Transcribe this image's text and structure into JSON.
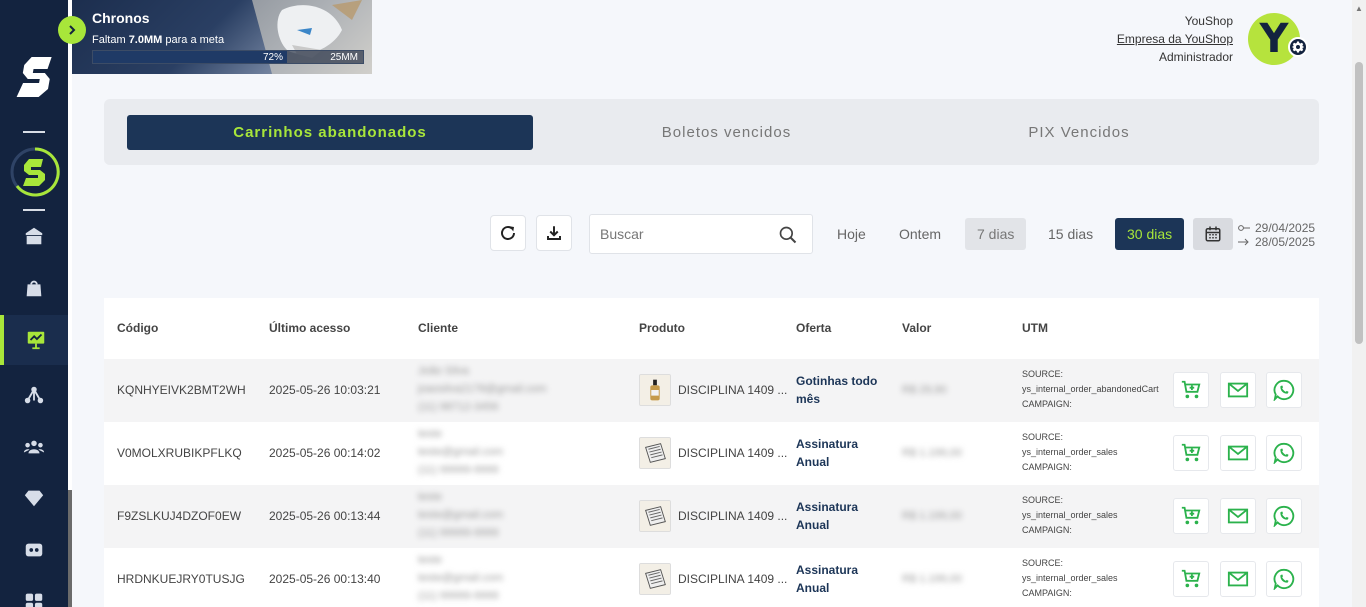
{
  "campaign": {
    "title": "Chronos",
    "subtitle_prefix": "Faltam",
    "subtitle_amount": "7.0MM",
    "subtitle_suffix": "para a meta",
    "progress_percent": 72,
    "progress_label": "72%",
    "goal_label": "25MM"
  },
  "user": {
    "name": "YouShop",
    "company": "Empresa da YouShop",
    "role": "Administrador",
    "avatar_letter": "Y"
  },
  "tabs": [
    {
      "label": "Carrinhos abandonados",
      "active": true
    },
    {
      "label": "Boletos vencidos",
      "active": false
    },
    {
      "label": "PIX Vencidos",
      "active": false
    }
  ],
  "toolbar": {
    "search_placeholder": "Buscar",
    "ranges": [
      "Hoje",
      "Ontem",
      "7 dias",
      "15 dias",
      "30 dias"
    ],
    "selected_range": "30 dias",
    "date_start": "29/04/2025",
    "date_end": "28/05/2025"
  },
  "table": {
    "headers": [
      "Código",
      "Último acesso",
      "Cliente",
      "Produto",
      "Oferta",
      "Valor",
      "UTM"
    ],
    "rows": [
      {
        "code": "KQNHYEIVK2BMT2WH",
        "last_access": "2025-05-26 10:03:21",
        "client": [
          "João Silva",
          "joaosilva2178@gmail.com",
          "(11) 98712-3456"
        ],
        "product": "DISCIPLINA 1409 ...",
        "offer": [
          "Gotinhas todo",
          "mês"
        ],
        "value": "R$ 29,90",
        "utm": [
          "SOURCE:",
          "ys_internal_order_abandonedCart",
          "CAMPAIGN:"
        ]
      },
      {
        "code": "V0MOLXRUBIKPFLKQ",
        "last_access": "2025-05-26 00:14:02",
        "client": [
          "teste",
          "teste@gmail.com",
          "(11) 99999-9999"
        ],
        "product": "DISCIPLINA 1409 ...",
        "offer": [
          "Assinatura",
          "Anual"
        ],
        "value": "R$ 1.199,00",
        "utm": [
          "SOURCE:",
          "ys_internal_order_sales",
          "CAMPAIGN:"
        ]
      },
      {
        "code": "F9ZSLKUJ4DZOF0EW",
        "last_access": "2025-05-26 00:13:44",
        "client": [
          "teste",
          "teste@gmail.com",
          "(11) 99999-9999"
        ],
        "product": "DISCIPLINA 1409 ...",
        "offer": [
          "Assinatura",
          "Anual"
        ],
        "value": "R$ 1.199,00",
        "utm": [
          "SOURCE:",
          "ys_internal_order_sales",
          "CAMPAIGN:"
        ]
      },
      {
        "code": "HRDNKUEJRY0TUSJG",
        "last_access": "2025-05-26 00:13:40",
        "client": [
          "teste",
          "teste@gmail.com",
          "(11) 99999-9999"
        ],
        "product": "DISCIPLINA 1409 ...",
        "offer": [
          "Assinatura",
          "Anual"
        ],
        "value": "R$ 1.199,00",
        "utm": [
          "SOURCE:",
          "ys_internal_order_sales",
          "CAMPAIGN:"
        ]
      }
    ]
  },
  "colors": {
    "sidebar": "#13233f",
    "accent": "#a8e63a",
    "navy": "#1c3557",
    "action_green": "#2bb24c"
  }
}
